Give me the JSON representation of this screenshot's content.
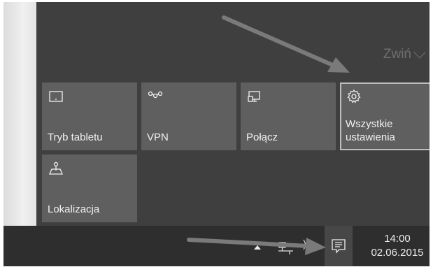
{
  "action_center": {
    "collapse_label": "Zwiń",
    "tiles": [
      {
        "label": "Tryb tabletu",
        "icon": "tablet-mode-icon"
      },
      {
        "label": "VPN",
        "icon": "vpn-icon"
      },
      {
        "label": "Połącz",
        "icon": "connect-icon"
      },
      {
        "label": "Wszystkie\nustawienia",
        "icon": "settings-gear-icon",
        "selected": true
      },
      {
        "label": "Lokalizacja",
        "icon": "location-icon"
      }
    ]
  },
  "taskbar": {
    "time": "14:00",
    "date": "02.06.2015",
    "icons": [
      "show-hidden-icons-arrow",
      "network-icon",
      "volume-icon",
      "action-center-icon"
    ]
  },
  "colors": {
    "background": "#3f3f3f",
    "tile": "#5f5f5f",
    "taskbar": "#2e2e2e",
    "text": "#f1f1f1"
  }
}
